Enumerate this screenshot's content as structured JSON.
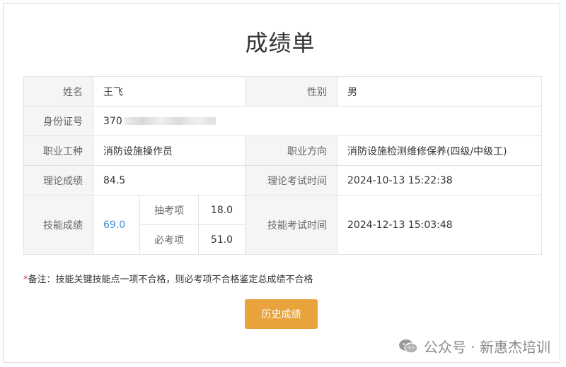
{
  "title": "成绩单",
  "labels": {
    "name": "姓名",
    "gender": "性别",
    "id_number": "身份证号",
    "occupation": "职业工种",
    "direction": "职业方向",
    "theory_score": "理论成绩",
    "theory_time": "理论考试时间",
    "skill_score": "技能成绩",
    "random_items": "抽考项",
    "required_items": "必考项",
    "skill_time": "技能考试时间"
  },
  "values": {
    "name": "王飞",
    "gender": "男",
    "id_number_visible": "370",
    "occupation": "消防设施操作员",
    "direction": "消防设施检测维修保养(四级/中级工)",
    "theory_score": "84.5",
    "theory_time": "2024-10-13 15:22:38",
    "skill_score": "69.0",
    "random_items_score": "18.0",
    "required_items_score": "51.0",
    "skill_time": "2024-12-13 15:03:48"
  },
  "note": {
    "star": "*",
    "text": "备注：技能关键技能点一项不合格，则必考项不合格鉴定总成绩不合格"
  },
  "history_button": "历史成绩",
  "watermark": "公众号 · 新惠杰培训",
  "colors": {
    "accent_button": "#e8a33d",
    "skill_score": "#3b8fd8",
    "note_star": "#e23a3a"
  }
}
